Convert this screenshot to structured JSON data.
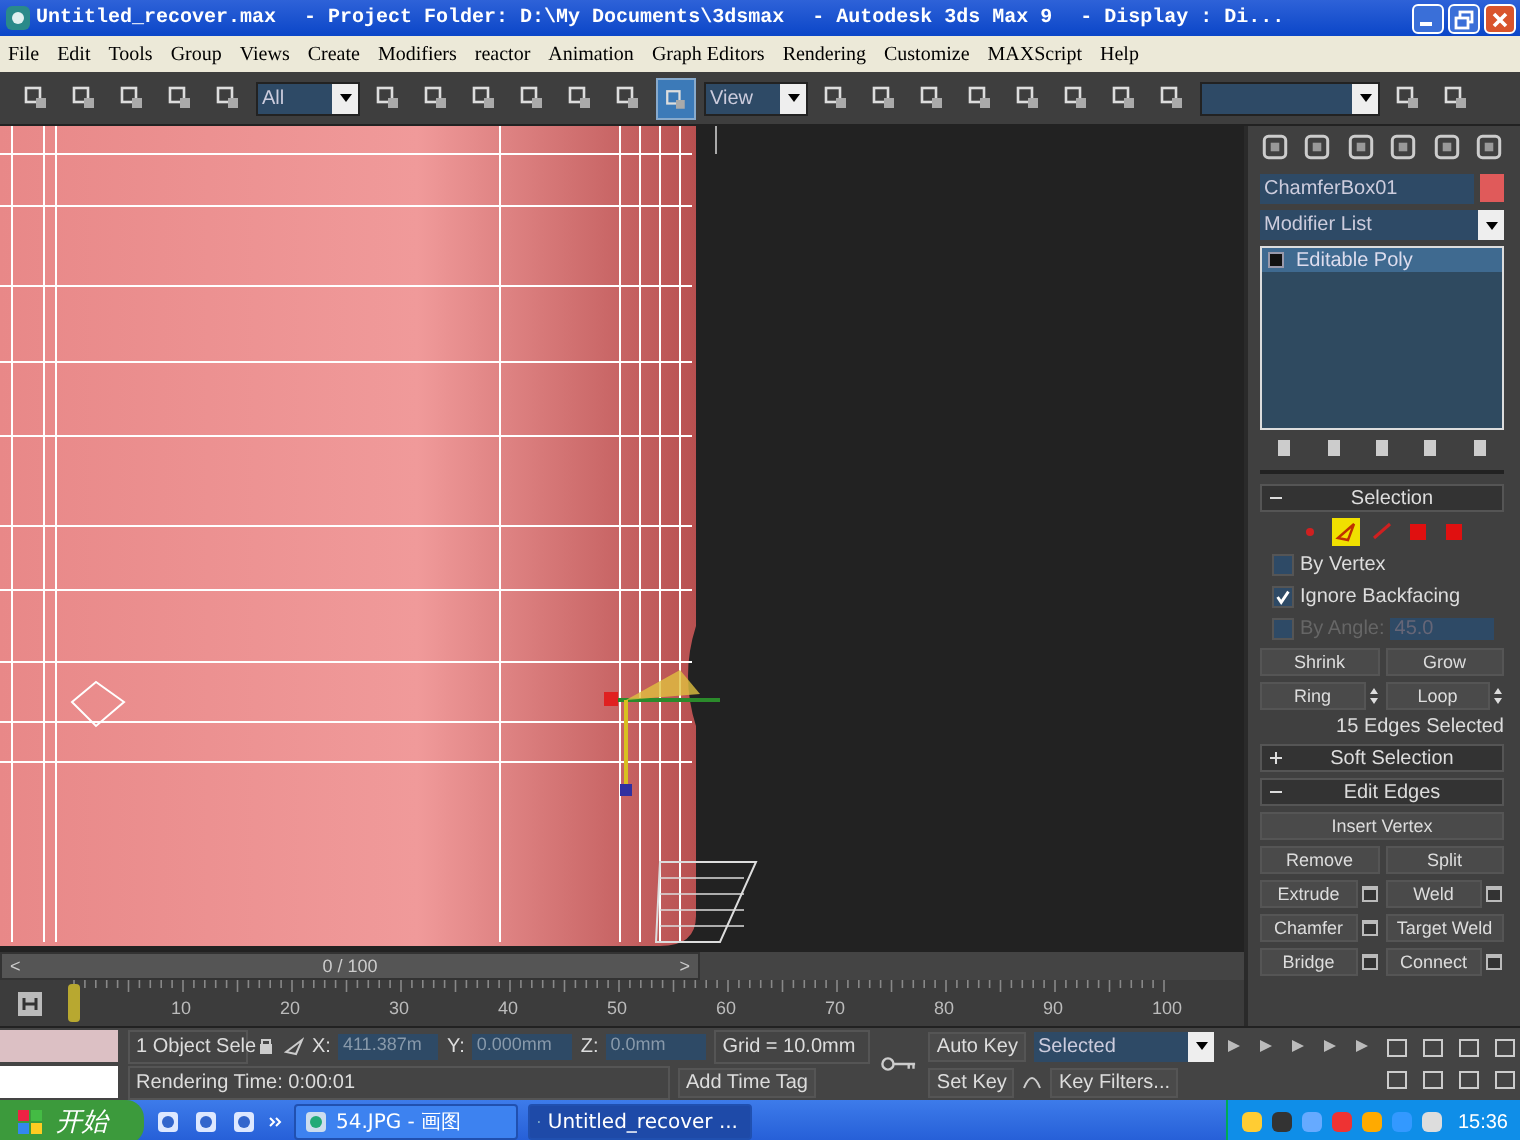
{
  "window": {
    "title_segments": [
      "Untitled_recover.max",
      "- Project Folder: D:\\My Documents\\3dsmax",
      "- Autodesk 3ds Max 9",
      "- Display : Di..."
    ]
  },
  "menu": [
    "File",
    "Edit",
    "Tools",
    "Group",
    "Views",
    "Create",
    "Modifiers",
    "reactor",
    "Animation",
    "Graph Editors",
    "Rendering",
    "Customize",
    "MAXScript",
    "Help"
  ],
  "toolbar": {
    "items": [
      {
        "kind": "icon",
        "selected": false
      },
      {
        "kind": "icon",
        "selected": false
      },
      {
        "kind": "icon",
        "selected": false
      },
      {
        "kind": "icon",
        "selected": false
      },
      {
        "kind": "icon",
        "selected": false
      },
      {
        "kind": "dropdown",
        "value": "All"
      },
      {
        "kind": "icon",
        "selected": false
      },
      {
        "kind": "icon",
        "selected": false
      },
      {
        "kind": "icon",
        "selected": false
      },
      {
        "kind": "icon",
        "selected": false
      },
      {
        "kind": "icon",
        "selected": false
      },
      {
        "kind": "icon",
        "selected": false
      },
      {
        "kind": "icon",
        "selected": true
      },
      {
        "kind": "dropdown",
        "value": "View"
      },
      {
        "kind": "icon",
        "selected": false
      },
      {
        "kind": "icon",
        "selected": false
      },
      {
        "kind": "icon",
        "selected": false
      },
      {
        "kind": "icon",
        "selected": false
      },
      {
        "kind": "icon",
        "selected": false
      },
      {
        "kind": "icon",
        "selected": false
      },
      {
        "kind": "icon",
        "selected": false
      },
      {
        "kind": "icon",
        "selected": false
      },
      {
        "kind": "dropdown",
        "value": null
      },
      {
        "kind": "icon",
        "selected": false
      },
      {
        "kind": "icon",
        "selected": false
      }
    ]
  },
  "command_panel": {
    "object_name": "ChamferBox01",
    "modifier_list": "Modifier List",
    "stack": [
      {
        "label": "Editable Poly",
        "selected": true
      }
    ],
    "rollouts": [
      {
        "title": "Selection",
        "expanded": true,
        "subobjects": [
          {
            "selected": false
          },
          {
            "selected": true
          },
          {
            "selected": false
          },
          {
            "selected": false
          },
          {
            "selected": false
          }
        ],
        "checkboxes": [
          {
            "label": "By Vertex",
            "checked": false,
            "disabled": false
          },
          {
            "label": "Ignore Backfacing",
            "checked": true,
            "disabled": false
          },
          {
            "label": "By Angle:",
            "checked": false,
            "disabled": true,
            "value": "45.0"
          }
        ],
        "button_rows": [
          [
            {
              "label": "Shrink",
              "spinner": false
            },
            {
              "label": "Grow",
              "spinner": false
            }
          ],
          [
            {
              "label": "Ring",
              "spinner": true
            },
            {
              "label": "Loop",
              "spinner": true
            }
          ]
        ],
        "info": "15 Edges Selected"
      },
      {
        "title": "Soft Selection",
        "expanded": false
      },
      {
        "title": "Edit Edges",
        "expanded": true,
        "button_rows": [
          [
            {
              "label": "Insert Vertex",
              "settings": false
            }
          ],
          [
            {
              "label": "Remove",
              "settings": false
            },
            {
              "label": "Split",
              "settings": false
            }
          ],
          [
            {
              "label": "Extrude",
              "settings": true
            },
            {
              "label": "Weld",
              "settings": true
            }
          ],
          [
            {
              "label": "Chamfer",
              "settings": true
            },
            {
              "label": "Target Weld",
              "settings": false
            }
          ],
          [
            {
              "label": "Bridge",
              "settings": true
            },
            {
              "label": "Connect",
              "settings": true
            }
          ]
        ]
      }
    ]
  },
  "timeline": {
    "level": 0,
    "frame": "0 / 100",
    "prev": "<",
    "next": ">",
    "ticks": [
      "10",
      "20",
      "30",
      "40",
      "50",
      "60",
      "70",
      "80",
      "90",
      "100"
    ]
  },
  "status": {
    "selection": "1 Object Sele",
    "x_label": "X:",
    "x": "411.387m",
    "y_label": "Y:",
    "y": "0.000mm",
    "z_label": "Z:",
    "z": "0.0mm",
    "grid": "Grid = 10.0mm",
    "add_time_tag": "Add Time Tag",
    "prompt": "Rendering Time: 0:00:01",
    "auto_key": "Auto Key",
    "key_mode": "Selected",
    "set_key": "Set Key",
    "key_filters": "Key Filters..."
  },
  "taskbar": {
    "start": "开始",
    "tasks": [
      {
        "label": "54.JPG - 画图",
        "selected": false
      },
      {
        "label": "Untitled_recover ...",
        "selected": true
      }
    ],
    "clock": "15:36"
  }
}
